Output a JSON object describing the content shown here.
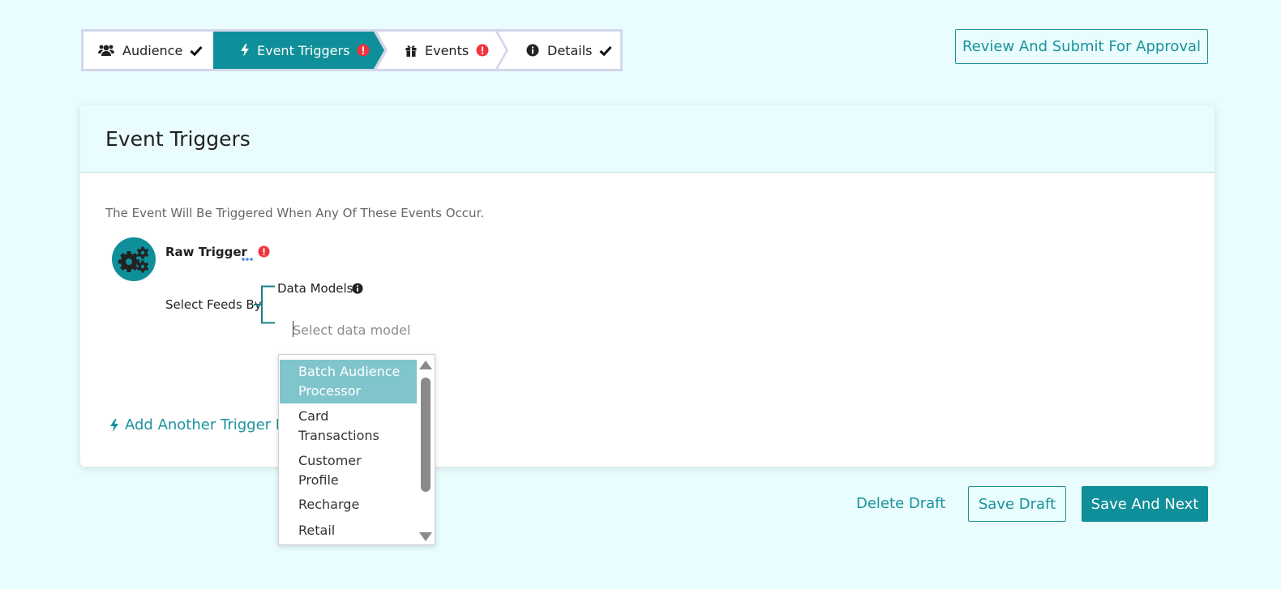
{
  "stepper": {
    "steps": [
      {
        "label": "Audience",
        "icon": "users-icon",
        "status": "complete"
      },
      {
        "label": "Event Triggers",
        "icon": "bolt-icon",
        "status": "error",
        "active": true
      },
      {
        "label": "Events",
        "icon": "gift-icon",
        "status": "error"
      },
      {
        "label": "Details",
        "icon": "info-icon",
        "status": "complete"
      }
    ],
    "colors": {
      "active_bg": "#0f8f99",
      "border": "#d3d6ea",
      "error": "#f0343e"
    }
  },
  "header": {
    "review_label": "Review And Submit For Approval"
  },
  "card": {
    "title": "Event Triggers",
    "description": "The Event Will Be Triggered When Any Of These Events Occur.",
    "trigger": {
      "title": "Raw Trigger",
      "icon": "gears-icon"
    },
    "feeds": {
      "label": "Select Feeds By",
      "data_models_label": "Data Models",
      "placeholder": "Select data model",
      "value": ""
    },
    "add_trigger_label": "Add Another Trigger Ev"
  },
  "dropdown": {
    "options": [
      {
        "lines": [
          "Batch Audience",
          "Processor"
        ],
        "selected": true
      },
      {
        "lines": [
          "Card",
          "Transactions"
        ],
        "selected": false
      },
      {
        "lines": [
          "Customer",
          "Profile"
        ],
        "selected": false
      },
      {
        "lines": [
          "Recharge"
        ],
        "selected": false
      },
      {
        "lines": [
          "Retail"
        ],
        "selected": false
      }
    ],
    "selected_color": "#80c5cc"
  },
  "footer": {
    "delete_label": "Delete Draft",
    "save_draft_label": "Save Draft",
    "save_next_label": "Save And Next"
  },
  "theme": {
    "accent": "#1b929b",
    "background": "#e9fdfe"
  }
}
